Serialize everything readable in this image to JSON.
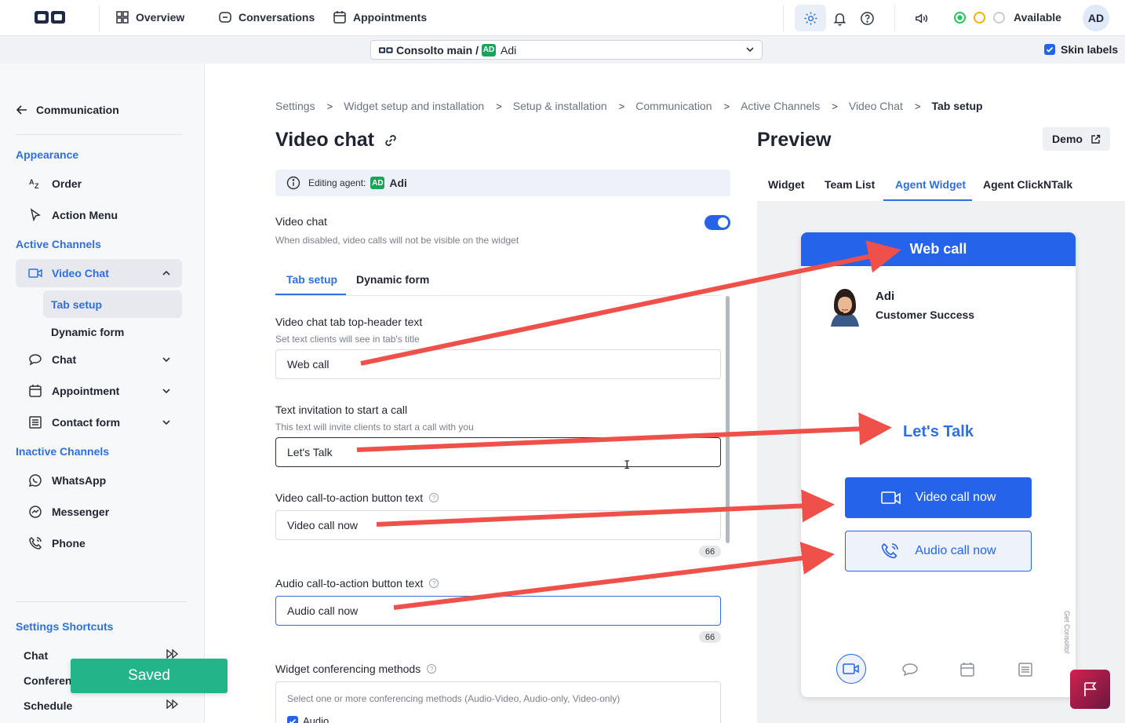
{
  "topnav": {
    "items": [
      {
        "label": "Overview",
        "icon": "grid-icon"
      },
      {
        "label": "Conversations",
        "icon": "chat-bubble-icon"
      },
      {
        "label": "Appointments",
        "icon": "calendar-icon"
      }
    ],
    "status_label": "Available",
    "status_colors": {
      "online": "#22c55e",
      "away": "#f5b301",
      "offline": "#c8ccd3"
    },
    "avatar_initials": "AD"
  },
  "subbar": {
    "account_prefix": "Consolto main /",
    "agent_badge": "AD",
    "agent_name": "Adi",
    "skin_labels": "Skin labels"
  },
  "sidebar": {
    "back_label": "Communication",
    "appearance": {
      "title": "Appearance",
      "items": [
        "Order",
        "Action Menu"
      ]
    },
    "active_channels": {
      "title": "Active Channels",
      "video_chat": "Video Chat",
      "sub_items": [
        "Tab setup",
        "Dynamic form"
      ],
      "items": [
        "Chat",
        "Appointment",
        "Contact form"
      ]
    },
    "inactive_channels": {
      "title": "Inactive Channels",
      "items": [
        "WhatsApp",
        "Messenger",
        "Phone"
      ]
    },
    "shortcuts": {
      "title": "Settings Shortcuts",
      "items": [
        "Chat",
        "Conferen",
        "Schedule"
      ]
    }
  },
  "toast": "Saved",
  "breadcrumb": [
    "Settings",
    "Widget setup and installation",
    "Setup & installation",
    "Communication",
    "Active Channels",
    "Video Chat",
    "Tab setup"
  ],
  "page_title": "Video chat",
  "editing_agent": {
    "label": "Editing agent:",
    "badge": "AD",
    "name": "Adi"
  },
  "toggle": {
    "label": "Video chat",
    "hint": "When disabled, video calls will not be visible on the widget",
    "enabled": true
  },
  "form_tabs": [
    "Tab setup",
    "Dynamic form"
  ],
  "fields": {
    "header_text": {
      "label": "Video chat tab top-header text",
      "hint": "Set text clients will see in tab's title",
      "value": "Web call"
    },
    "invitation": {
      "label": "Text invitation to start a call",
      "hint": "This text will invite clients to start a call with you",
      "value": "Let's Talk"
    },
    "video_cta": {
      "label": "Video call-to-action button text",
      "value": "Video call now",
      "counter": "66"
    },
    "audio_cta": {
      "label": "Audio call-to-action button text",
      "value": "Audio call now",
      "counter": "66"
    },
    "conferencing": {
      "label": "Widget conferencing methods",
      "hint": "Select one or more conferencing methods (Audio-Video, Audio-only, Video-only)",
      "option": "Audio"
    }
  },
  "preview": {
    "title": "Preview",
    "demo_label": "Demo",
    "tabs": [
      "Widget",
      "Team List",
      "Agent Widget",
      "Agent ClickNTalk"
    ],
    "widget": {
      "header": "Web call",
      "agent_name": "Adi",
      "agent_role": "Customer Success",
      "invitation": "Let's Talk",
      "video_btn": "Video call now",
      "audio_btn": "Audio call now",
      "footer_link": "Get Consolto!"
    }
  },
  "colors": {
    "accent": "#2563eb",
    "annotation_arrow": "#f0504a",
    "toast": "#23b489"
  }
}
